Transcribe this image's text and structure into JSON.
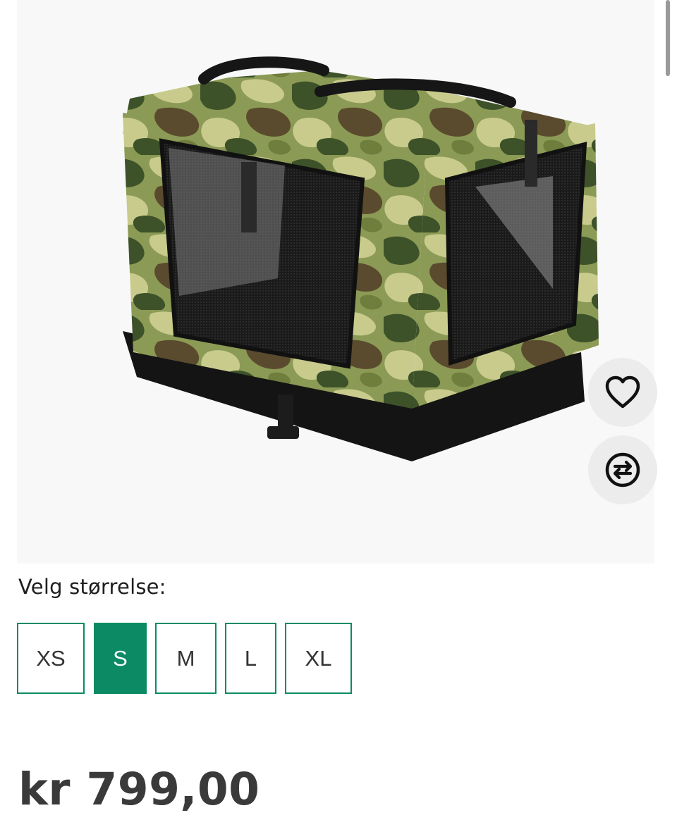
{
  "product": {
    "image_alt": "camouflage pet carrier",
    "favorite_icon": "heart-outline-icon",
    "compare_icon": "swap-arrows-icon"
  },
  "size_selector": {
    "label": "Velg størrelse:",
    "options": [
      "XS",
      "S",
      "M",
      "L",
      "XL"
    ],
    "selected": "S",
    "accent_color": "#0b8a63"
  },
  "price": {
    "text": "kr 799,00"
  }
}
